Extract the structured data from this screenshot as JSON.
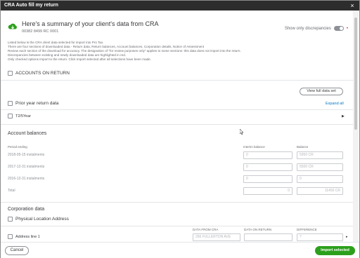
{
  "window": {
    "title": "CRA Auto fill my return",
    "close_glyph": "×"
  },
  "header": {
    "title": "Here's a summary of your client's data from CRA",
    "business_number": "00382 8499 RC 0001",
    "logo_icon": "cloud-download-icon",
    "toggle_label": "Show only discrepancies",
    "red_dot": "•"
  },
  "description": [
    "Listed below is the CRA client data selected for import into Pro Tax.",
    "There are four sections of downloaded data - Return data, Return balances, Account balances, Corporation details, Notice of Assessment",
    "Review each section of the download for accuracy. The designation of \"for review purposes only\" applies to some sections: this data does not import into the return.",
    "Discrepancies between existing and newly downloaded data are highlighted in red.",
    "Only checked options import to the return. Click Import selected after all selections have been made."
  ],
  "accounts_on_return": "ACCOUNTS ON RETURN",
  "view_full_data_set": "View full data set",
  "prior_year": {
    "label": "Prior year return data",
    "expand_all": "Expand all"
  },
  "t2_5year": "T2/5Year",
  "account_balances": {
    "title": "Account balances",
    "col_period": "Period ending",
    "col_interim": "Interim balance",
    "col_balance": "Balance",
    "rows": [
      {
        "period": "2018-05-15 instalments",
        "interim": "0",
        "balance": "5950 CR"
      },
      {
        "period": "2017-12-31 instalments",
        "interim": "0",
        "balance": "5500 CR"
      },
      {
        "period": "2016-12-31 instalments",
        "interim": "0",
        "balance": "0"
      },
      {
        "period": "Total",
        "interim": "0",
        "balance": "11450 CR"
      }
    ]
  },
  "corporation_data": {
    "title": "Corporation data",
    "physical_location": "Physical Location Address",
    "address_line": "Address line 1",
    "col_data_from_cra": "DATA FROM CRA",
    "col_data_on_return": "DATA ON RETURN",
    "col_difference": "DIFFERENCE",
    "address_value": "266 FULLERTON AVE",
    "difference_value": "?"
  },
  "footer": {
    "cancel": "Cancel",
    "import_selected": "Import selected"
  },
  "colors": {
    "primary_green": "#2ca01c",
    "link_blue": "#0077c5",
    "title_bar": "#2d2d2d",
    "discrepancy_red": "#d52b1e"
  }
}
